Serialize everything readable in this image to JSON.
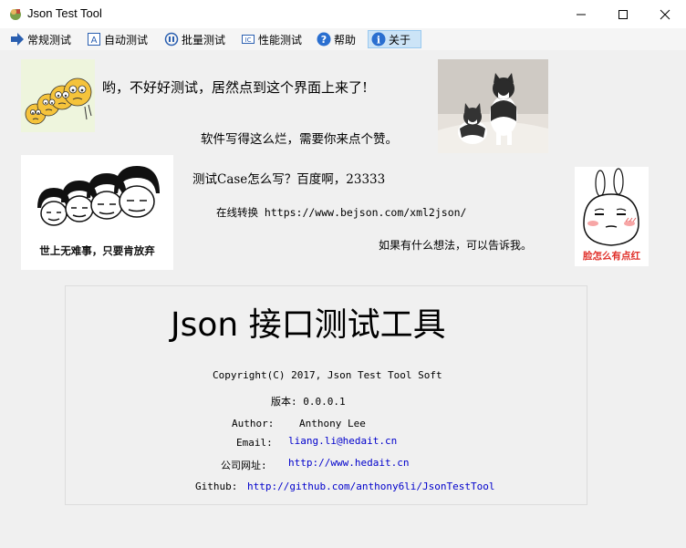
{
  "window": {
    "title": "Json Test Tool",
    "icon": "app-icon",
    "controls": {
      "minimize": "—",
      "maximize": "☐",
      "close": "✕"
    }
  },
  "menu": {
    "items": [
      {
        "label": "常规测试",
        "icon": "arrow-right-icon"
      },
      {
        "label": "自动测试",
        "icon": "auto-test-icon"
      },
      {
        "label": "批量测试",
        "icon": "batch-test-icon"
      },
      {
        "label": "性能测试",
        "icon": "performance-test-icon"
      },
      {
        "label": "帮助",
        "icon": "help-icon"
      },
      {
        "label": "关于",
        "icon": "info-icon",
        "active": true
      }
    ]
  },
  "about": {
    "line1": "哟，不好好测试，居然点到这个界面上来了!",
    "line2": "软件写得这么烂，需要你来点个赞。",
    "line3": "测试Case怎么写？百度啊，23333",
    "line4": "在线转换 https://www.bejson.com/xml2json/",
    "line5": "如果有什么想法，可以告诉我。",
    "meme_left_caption": "世上无难事，只要肯放弃",
    "meme_right_caption": "脸怎么有点红"
  },
  "info": {
    "title": "Json 接口测试工具",
    "copyright": "Copyright(C) 2017, Json Test Tool Soft",
    "version": "版本: 0.0.0.1",
    "author_label": "Author:",
    "author_value": "Anthony Lee",
    "email_label": "Email:",
    "email_value": "liang.li@hedait.cn",
    "site_label": "公司网址:",
    "site_value": "http://www.hedait.cn",
    "github_label": "Github:",
    "github_value": "http://github.com/anthony6li/JsonTestTool"
  },
  "colors": {
    "background": "#f0f0f0",
    "link": "#0000cc",
    "active_menu": "#cce4f7",
    "meme_caption": "#e0302a"
  }
}
